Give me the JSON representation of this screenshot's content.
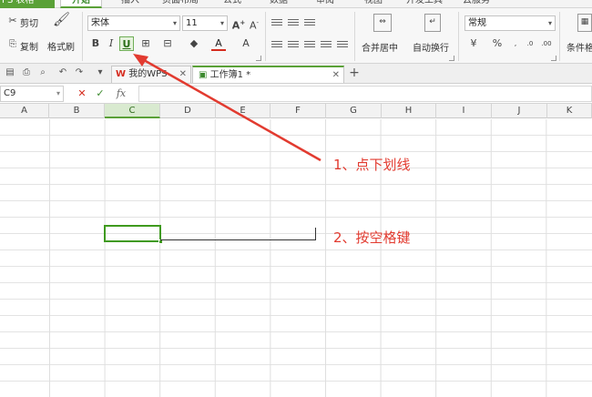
{
  "app": {
    "name": "PS 表格"
  },
  "menu_tabs": [
    "开始",
    "插入",
    "页面布局",
    "公式",
    "数据",
    "审阅",
    "视图",
    "开发工具",
    "云服务"
  ],
  "clipboard": {
    "cut": "剪切",
    "copy": "复制",
    "format_painter": "格式刷"
  },
  "font": {
    "name": "宋体",
    "size": "11",
    "bold": "B",
    "italic": "I",
    "underline": "U"
  },
  "alignment": {
    "merge_center": "合并居中",
    "wrap_text": "自动换行"
  },
  "number": {
    "format": "常规",
    "percent": "%"
  },
  "styles": {
    "conditional": "条件格"
  },
  "doc_tabs": [
    {
      "label": "我的WPS"
    },
    {
      "label": "工作簿1 *"
    }
  ],
  "formula_bar": {
    "cell_ref": "C9",
    "fx": "fx"
  },
  "columns": [
    "A",
    "B",
    "C",
    "D",
    "E",
    "F",
    "G",
    "H",
    "I",
    "J",
    "K"
  ],
  "selected_column": "C",
  "annotations": {
    "step1": "1、点下划线",
    "step2": "2、按空格键"
  },
  "colors": {
    "accent": "#5aa137",
    "annotation": "#e23b30"
  }
}
